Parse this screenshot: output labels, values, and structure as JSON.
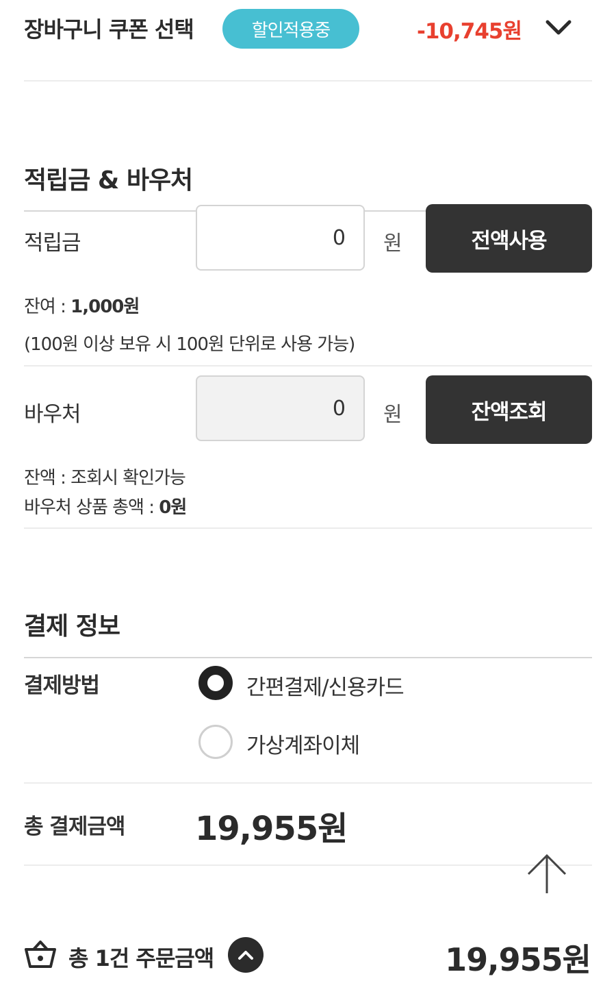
{
  "coupon": {
    "title": "장바구니 쿠폰 선택",
    "badge": "할인적용중",
    "amount": "-10,745원",
    "accent_color": "#e8402f",
    "badge_color": "#47bfd2",
    "chevron_icon": "chevron-down-icon"
  },
  "points_section": {
    "title": "적립금 & 바우처",
    "points": {
      "label": "적립금",
      "value": "0",
      "unit": "원",
      "button": "전액사용",
      "balance_label": "잔여 : ",
      "balance_value": "1,000원",
      "note": "(100원 이상 보유 시 100원 단위로 사용 가능)"
    },
    "voucher": {
      "label": "바우처",
      "value": "0",
      "unit": "원",
      "button": "잔액조회",
      "balance_text": "잔액 : 조회시 확인가능",
      "total_label": "바우처 상품 총액 : ",
      "total_value": "0원"
    }
  },
  "payment": {
    "title": "결제 정보",
    "method_label": "결제방법",
    "methods": [
      {
        "label": "간편결제/신용카드",
        "selected": true
      },
      {
        "label": "가상계좌이체",
        "selected": false
      }
    ],
    "total_label": "총 결제금액",
    "total_amount": "19,955원"
  },
  "footer": {
    "basket_icon": "basket-icon",
    "label": "총 1건 주문금액",
    "toggle_icon": "chevron-up-icon",
    "amount": "19,955원"
  },
  "scroll_top_icon": "arrow-up-icon"
}
